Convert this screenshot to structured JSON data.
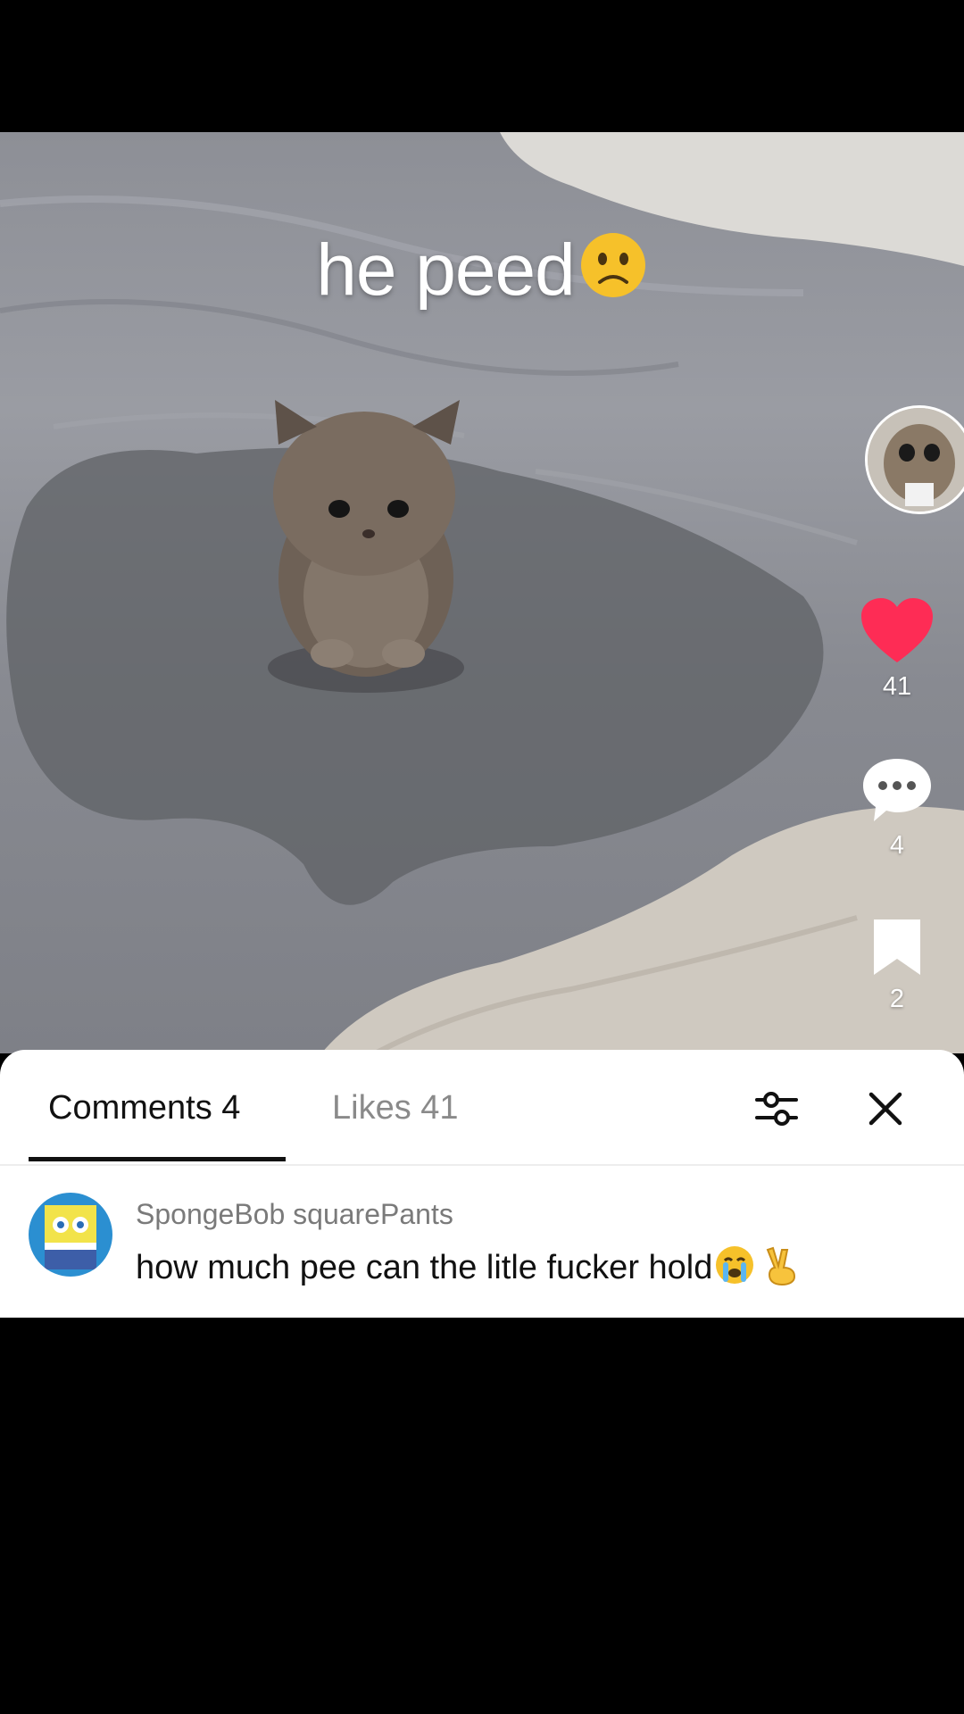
{
  "video": {
    "caption": "he peed",
    "caption_emoji": "frowning-face-emoji"
  },
  "rail": {
    "likes_count": "41",
    "comments_count": "4",
    "saves_count": "2",
    "heart_color": "#fe2c55"
  },
  "comments_panel": {
    "tabs": [
      {
        "label": "Comments 4",
        "active": true
      },
      {
        "label": "Likes 41",
        "active": false
      }
    ],
    "comments": [
      {
        "username": "SpongeBob squarePants",
        "text": "how much pee can the litle fucker hold",
        "emojis": [
          "loudly-crying-face-emoji",
          "victory-hand-emoji"
        ]
      }
    ]
  }
}
